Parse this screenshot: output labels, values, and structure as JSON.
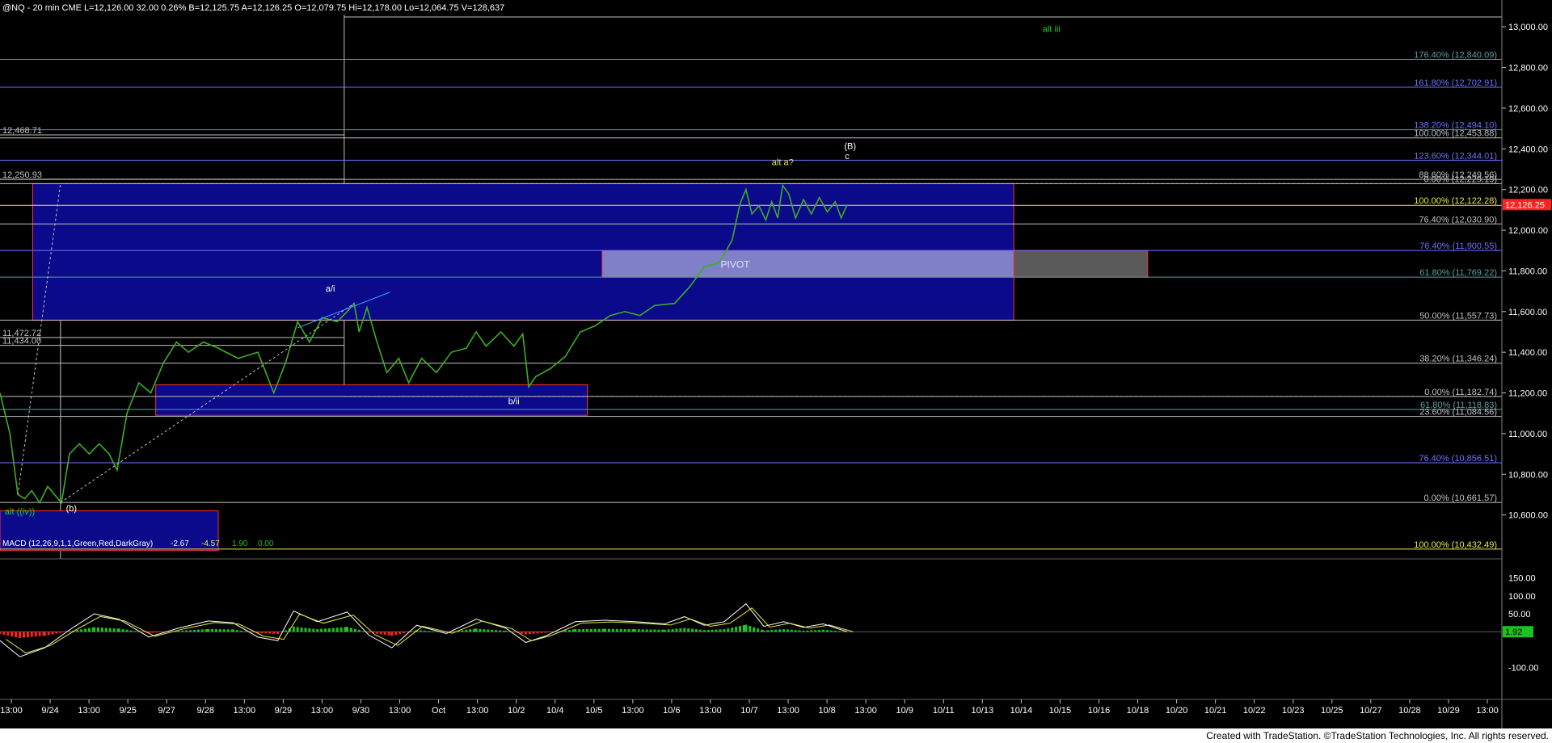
{
  "chart_data": {
    "type": "candlestick",
    "header": "@NQ - 20 min   CME   L=12,126.00   32.00   0.26%   B=12,125.75   A=12,126.25   O=12,079.75   Hi=12,178.00   Lo=12,064.75   V=128,637",
    "symbol": "@NQ",
    "interval": "20 min",
    "exchange": "CME",
    "quote": {
      "last": 12126.0,
      "change": 32.0,
      "change_pct": 0.26,
      "bid": 12125.75,
      "ask": 12126.25,
      "open": 12079.75,
      "high": 12178.0,
      "low": 12064.75,
      "volume": 128637
    },
    "price_axis": {
      "ylim": [
        10400,
        13100
      ],
      "ticks": [
        10600,
        10800,
        11000,
        11200,
        11400,
        11600,
        11800,
        12000,
        12200,
        12400,
        12600,
        12800,
        13000
      ],
      "tick_labels": [
        "10,600.00",
        "10,800.00",
        "11,000.00",
        "11,200.00",
        "11,400.00",
        "11,600.00",
        "11,800.00",
        "12,000.00",
        "12,200.00",
        "12,400.00",
        "12,600.00",
        "12,800.00",
        "13,000.00"
      ],
      "last_price_label": "12,126.25"
    },
    "time_axis": {
      "labels": [
        "13:00",
        "9/24",
        "13:00",
        "9/25",
        "9/27",
        "9/28",
        "13:00",
        "9/29",
        "13:00",
        "9/30",
        "13:00",
        "Oct",
        "13:00",
        "10/2",
        "10/4",
        "10/5",
        "13:00",
        "10/6",
        "13:00",
        "10/7",
        "13:00",
        "10/8",
        "13:00",
        "10/9",
        "10/11",
        "10/13",
        "10/14",
        "10/15",
        "10/16",
        "10/18",
        "10/20",
        "10/21",
        "10/22",
        "10/23",
        "10/25",
        "10/27",
        "10/28",
        "10/29",
        "13:00"
      ]
    },
    "price_path": [
      [
        0,
        11200
      ],
      [
        10,
        11000
      ],
      [
        18,
        10700
      ],
      [
        25,
        10680
      ],
      [
        32,
        10720
      ],
      [
        40,
        10660
      ],
      [
        48,
        10740
      ],
      [
        55,
        10700
      ],
      [
        62,
        10660
      ],
      [
        70,
        10900
      ],
      [
        80,
        10950
      ],
      [
        90,
        10900
      ],
      [
        100,
        10950
      ],
      [
        110,
        10900
      ],
      [
        118,
        10820
      ],
      [
        128,
        11100
      ],
      [
        140,
        11250
      ],
      [
        152,
        11200
      ],
      [
        165,
        11350
      ],
      [
        178,
        11450
      ],
      [
        190,
        11400
      ],
      [
        205,
        11450
      ],
      [
        220,
        11420
      ],
      [
        240,
        11370
      ],
      [
        260,
        11400
      ],
      [
        276,
        11200
      ],
      [
        288,
        11350
      ],
      [
        300,
        11550
      ],
      [
        312,
        11450
      ],
      [
        325,
        11570
      ],
      [
        340,
        11550
      ],
      [
        350,
        11600
      ],
      [
        357,
        11640
      ],
      [
        362,
        11500
      ],
      [
        370,
        11620
      ],
      [
        380,
        11450
      ],
      [
        390,
        11300
      ],
      [
        402,
        11370
      ],
      [
        412,
        11250
      ],
      [
        425,
        11370
      ],
      [
        440,
        11300
      ],
      [
        455,
        11400
      ],
      [
        470,
        11420
      ],
      [
        480,
        11500
      ],
      [
        490,
        11430
      ],
      [
        505,
        11500
      ],
      [
        518,
        11430
      ],
      [
        527,
        11490
      ],
      [
        533,
        11230
      ],
      [
        540,
        11280
      ],
      [
        555,
        11320
      ],
      [
        570,
        11380
      ],
      [
        585,
        11500
      ],
      [
        600,
        11530
      ],
      [
        615,
        11580
      ],
      [
        630,
        11600
      ],
      [
        645,
        11580
      ],
      [
        660,
        11630
      ],
      [
        680,
        11640
      ],
      [
        695,
        11720
      ],
      [
        710,
        11820
      ],
      [
        725,
        11840
      ],
      [
        738,
        11950
      ],
      [
        746,
        12130
      ],
      [
        752,
        12200
      ],
      [
        758,
        12080
      ],
      [
        765,
        12120
      ],
      [
        772,
        12050
      ],
      [
        778,
        12140
      ],
      [
        784,
        12060
      ],
      [
        789,
        12220
      ],
      [
        795,
        12180
      ],
      [
        802,
        12060
      ],
      [
        810,
        12150
      ],
      [
        818,
        12080
      ],
      [
        826,
        12160
      ],
      [
        834,
        12090
      ],
      [
        842,
        12140
      ],
      [
        848,
        12060
      ],
      [
        854,
        12126
      ]
    ],
    "macd": {
      "label": "MACD (12,26,9,1,1,Green,Red,DarkGray)",
      "macd": -2.67,
      "signal": -4.57,
      "diff": 1.9,
      "zero": 0.0,
      "y_ticks": [
        150,
        100,
        50,
        -100
      ],
      "tick_labels": [
        "150.00",
        "100.00",
        "50.00",
        "-100.00"
      ],
      "current_label": "1.92",
      "ylim": [
        -180,
        190
      ],
      "path": [
        [
          0,
          -25
        ],
        [
          20,
          -70
        ],
        [
          45,
          -45
        ],
        [
          70,
          5
        ],
        [
          95,
          50
        ],
        [
          120,
          35
        ],
        [
          150,
          -15
        ],
        [
          180,
          10
        ],
        [
          210,
          30
        ],
        [
          235,
          25
        ],
        [
          260,
          -15
        ],
        [
          280,
          -25
        ],
        [
          296,
          58
        ],
        [
          320,
          28
        ],
        [
          350,
          55
        ],
        [
          372,
          -10
        ],
        [
          395,
          -45
        ],
        [
          420,
          18
        ],
        [
          450,
          -5
        ],
        [
          480,
          35
        ],
        [
          510,
          10
        ],
        [
          530,
          -30
        ],
        [
          550,
          -12
        ],
        [
          580,
          28
        ],
        [
          610,
          32
        ],
        [
          640,
          28
        ],
        [
          670,
          22
        ],
        [
          690,
          42
        ],
        [
          710,
          18
        ],
        [
          730,
          28
        ],
        [
          752,
          78
        ],
        [
          770,
          15
        ],
        [
          790,
          28
        ],
        [
          810,
          12
        ],
        [
          830,
          22
        ],
        [
          854,
          0
        ]
      ]
    },
    "horizontal_levels": [
      {
        "price": 12840.09,
        "label": "176.40% (12,840.09)",
        "color": "#5f9ea0"
      },
      {
        "price": 12702.91,
        "label": "161.80% (12,702.91)",
        "color": "#7070ff"
      },
      {
        "price": 12494.1,
        "label": "138.20% (12,494.10)",
        "color": "#7070ff"
      },
      {
        "price": 12453.88,
        "label": "100.00% (12,453.88)",
        "color": "#c0c0c0"
      },
      {
        "price": 12344.01,
        "label": "123.60% (12,344.01)",
        "color": "#7070ff"
      },
      {
        "price": 12249.56,
        "label": "88.60% (12,249.56)",
        "color": "#c0c0c0"
      },
      {
        "price": 12229.19,
        "label": "0.00% (12,229.19)",
        "color": "#c0c0c0"
      },
      {
        "price": 12122.28,
        "label": "100.00% (12,122.28)",
        "color": "#e8e84a"
      },
      {
        "price": 12030.9,
        "label": "76.40% (12,030.90)",
        "color": "#c0c0c0"
      },
      {
        "price": 11900.55,
        "label": "76.40% (11,900.55)",
        "color": "#7070ff"
      },
      {
        "price": 11769.22,
        "label": "61.80% (11,769.22)",
        "color": "#5f9ea0"
      },
      {
        "price": 11557.73,
        "label": "50.00% (11,557.73)",
        "color": "#c0c0c0"
      },
      {
        "price": 11346.24,
        "label": "38.20% (11,346.24)",
        "color": "#c0c0c0"
      },
      {
        "price": 11182.74,
        "label": "0.00% (11,182.74)",
        "color": "#c0c0c0"
      },
      {
        "price": 11118.83,
        "label": "61.80% (11,118.83)",
        "color": "#5f9ea0"
      },
      {
        "price": 11084.56,
        "label": "23.60% (11,084.56)",
        "color": "#c0c0c0"
      },
      {
        "price": 10856.51,
        "label": "76.40% (10,856.51)",
        "color": "#7070ff"
      },
      {
        "price": 10661.57,
        "label": "0.00% (10,661.57)",
        "color": "#c0c0c0"
      },
      {
        "price": 10432.49,
        "label": "100.00% (10,432.49)",
        "color": "#e8e84a"
      }
    ],
    "left_price_labels": [
      {
        "price": 12468.71,
        "label": "12,468.71"
      },
      {
        "price": 12250.93,
        "label": "12,250.93"
      },
      {
        "price": 11472.72,
        "label": "11,472.72"
      },
      {
        "price": 11434.0,
        "label": "11,434.00"
      }
    ],
    "zones": [
      {
        "x0": 33,
        "x1": 1022,
        "p0": 11557,
        "p1": 12229,
        "fill": "#0a0a8a",
        "stroke": "#ff3030"
      },
      {
        "x0": 157,
        "x1": 592,
        "p0": 11090,
        "p1": 11240,
        "fill": "#0a0a8a",
        "stroke": "#ff3030"
      },
      {
        "x0": 0,
        "x1": 220,
        "p0": 10425,
        "p1": 10620,
        "fill": "#0a0a8a",
        "stroke": "#ff3030"
      },
      {
        "x0": 607,
        "x1": 1022,
        "p0": 11769,
        "p1": 11900,
        "fill": "#8080c8",
        "stroke": "#ff3030",
        "label": "PIVOT"
      },
      {
        "x0": 1022,
        "x1": 1157,
        "p0": 11769,
        "p1": 11900,
        "fill": "#5a5a5a",
        "stroke": "#ff3030"
      }
    ],
    "annotations": [
      {
        "text": "alt iii",
        "x": 1060,
        "price": 12975,
        "color": "#22cc22"
      },
      {
        "text": "(B)",
        "x": 857,
        "price": 12399,
        "color": "#ffffff"
      },
      {
        "text": "c",
        "x": 854,
        "price": 12350,
        "color": "#ffffff"
      },
      {
        "text": "alt a?",
        "x": 789,
        "price": 12320,
        "color": "#e8e84a"
      },
      {
        "text": "a/i",
        "x": 333,
        "price": 11698,
        "color": "#ffffff"
      },
      {
        "text": "b/ii",
        "x": 518,
        "price": 11145,
        "color": "#ffffff"
      },
      {
        "text": "(b)",
        "x": 72,
        "price": 10618,
        "color": "#ffffff"
      },
      {
        "text": "alt ((iv))",
        "x": 20,
        "price": 10602,
        "color": "#22cc22"
      }
    ]
  },
  "footer": {
    "text": "Created with TradeStation. ©TradeStation Technologies, Inc. All rights reserved."
  }
}
